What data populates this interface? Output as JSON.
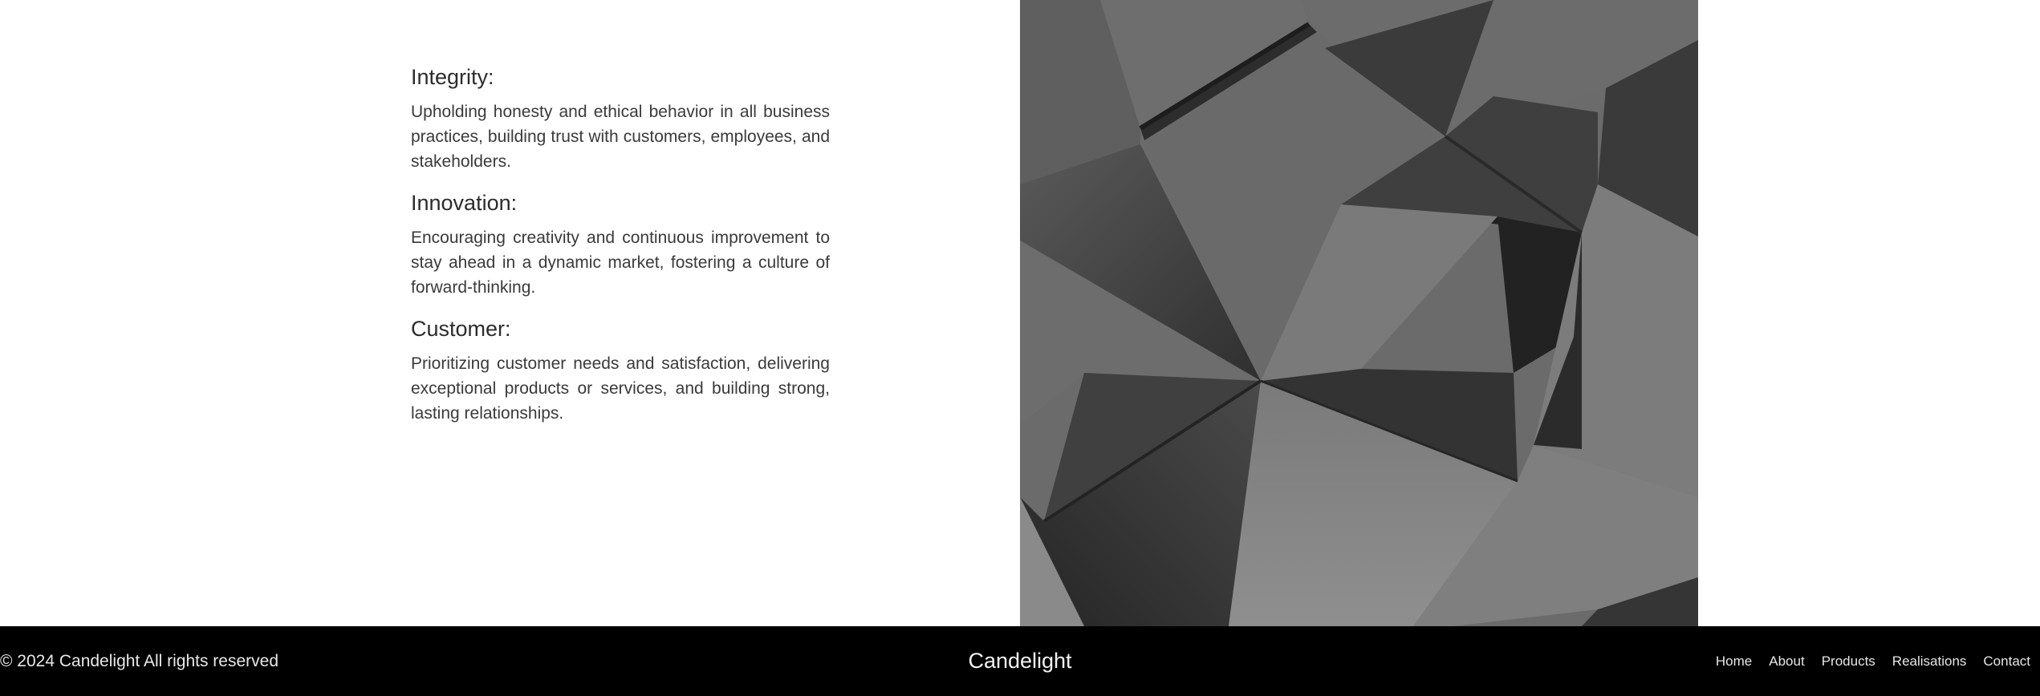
{
  "values": [
    {
      "title": "Integrity:",
      "description": "Upholding honesty and ethical behavior in all business practices, building trust with customers, employees, and stakeholders."
    },
    {
      "title": "Innovation:",
      "description": "Encouraging creativity and continuous improvement to stay ahead in a dynamic market, fostering a culture of forward-thinking."
    },
    {
      "title": "Customer:",
      "description": "Prioritizing customer needs and satisfaction, delivering exceptional products or services, and building strong, lasting relationships."
    }
  ],
  "image": {
    "icon": "abstract-geometric-image",
    "colors": {
      "light": "#8c8c8c",
      "mid": "#666666",
      "dark": "#3c3c3c"
    }
  },
  "footer": {
    "copyright": "© 2024 Candelight All rights reserved",
    "brand": "Candelight",
    "nav": [
      "Home",
      "About",
      "Products",
      "Realisations",
      "Contact"
    ],
    "background": "#000000"
  }
}
